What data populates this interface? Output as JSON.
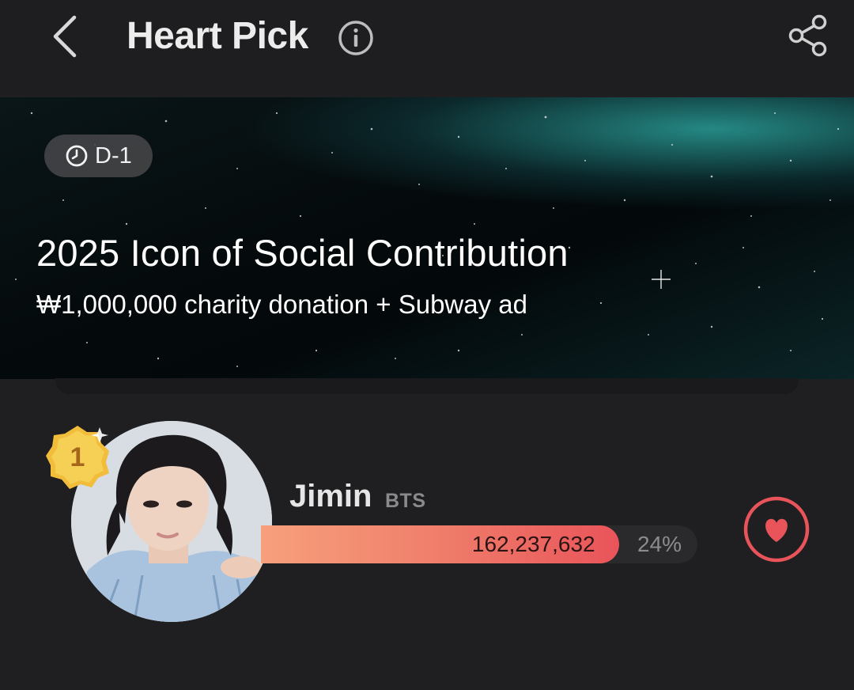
{
  "header": {
    "title": "Heart Pick",
    "back_icon": "chevron-left-icon",
    "info_icon": "info-icon",
    "share_icon": "share-icon"
  },
  "banner": {
    "dday": "D-1",
    "dday_icon": "clock-icon",
    "title": "2025 Icon of Social Contribution",
    "subtitle": "₩1,000,000 charity donation + Subway ad"
  },
  "ranking": [
    {
      "rank": "1",
      "name": "Jimin",
      "group": "BTS",
      "votes": "162,237,632",
      "percent": "24%",
      "bar_fraction": 0.82,
      "vote_icon": "heart-icon"
    }
  ],
  "colors": {
    "background": "#1f1f21",
    "accent": "#e9545a",
    "bar_start": "#f7a07c",
    "badge_gold": "#f5c542"
  }
}
